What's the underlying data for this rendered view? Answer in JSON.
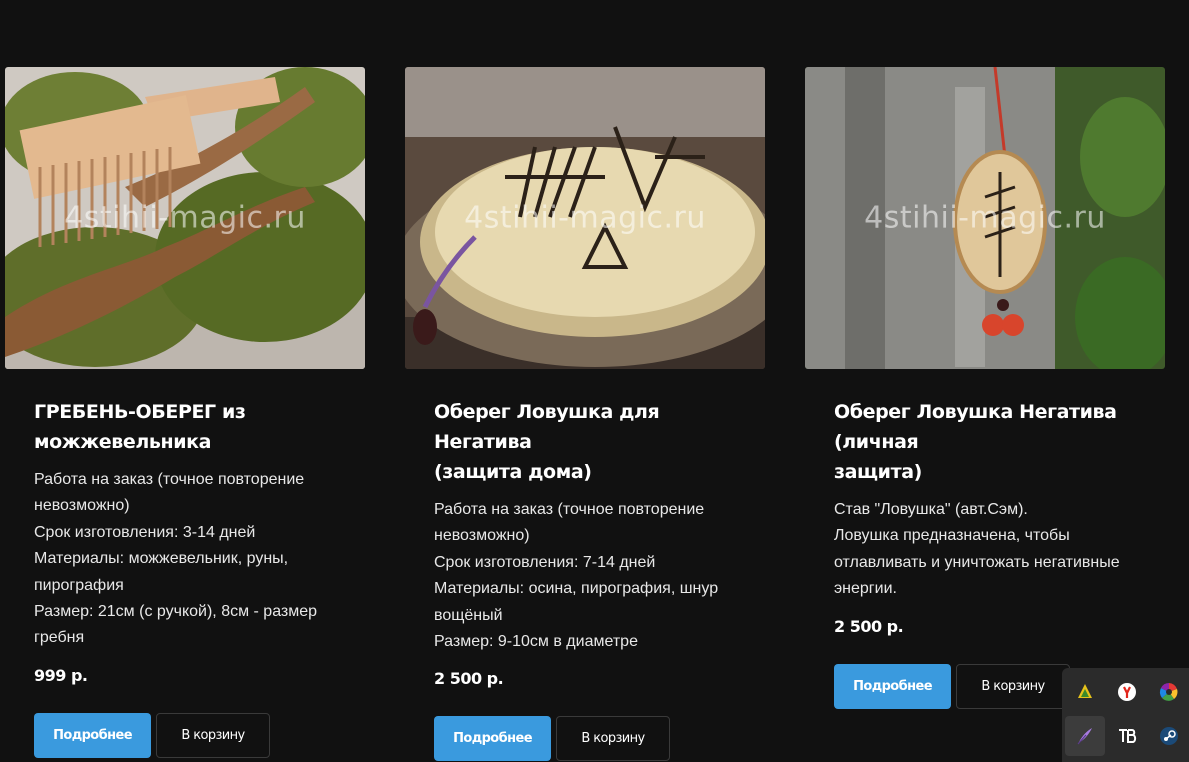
{
  "products": [
    {
      "title_lines": [
        "ГРЕБЕНЬ-ОБЕРЕГ из",
        "можжевельника"
      ],
      "watermark": "4stihii-magic.ru",
      "desc_lines": [
        "Работа на заказ (точное повторение",
        "невозможно)",
        "Срок изготовления: 3-14 дней",
        "Материалы: можжевельник, руны,",
        "пирография",
        "Размер: 21см (с ручкой), 8см - размер",
        "гребня"
      ],
      "price": "999 р.",
      "more_label": "Подробнее",
      "cart_label": "В корзину"
    },
    {
      "title_lines": [
        "Оберег Ловушка для Негатива",
        "(защита дома)"
      ],
      "watermark": "4stihii-magic.ru",
      "desc_lines": [
        "Работа на заказ (точное повторение",
        "невозможно)",
        "Срок изготовления: 7-14 дней",
        "Материалы: осина, пирография, шнур",
        "вощёный",
        "Размер: 9-10см в диаметре"
      ],
      "price": "2 500 р.",
      "more_label": "Подробнее",
      "cart_label": "В корзину"
    },
    {
      "title_lines": [
        "Оберег Ловушка Негатива (личная",
        "защита)"
      ],
      "watermark": "4stihii-magic.ru",
      "desc_lines": [
        "Став \"Ловушка\" (авт.Сэм).",
        "Ловушка предназначена, чтобы",
        "отлавливать и уничтожать негативные",
        "энергии."
      ],
      "price": "2 500 р.",
      "more_label": "Подробнее",
      "cart_label": "В корзину"
    }
  ],
  "tray_icons": [
    "tree-app-icon",
    "yandex-browser-icon",
    "color-wheel-icon",
    "feather-pen-icon",
    "tb-app-icon",
    "steam-icon"
  ],
  "colors": {
    "background": "#111111",
    "accent": "#3a9ade",
    "tray": "#2b2b2b"
  }
}
